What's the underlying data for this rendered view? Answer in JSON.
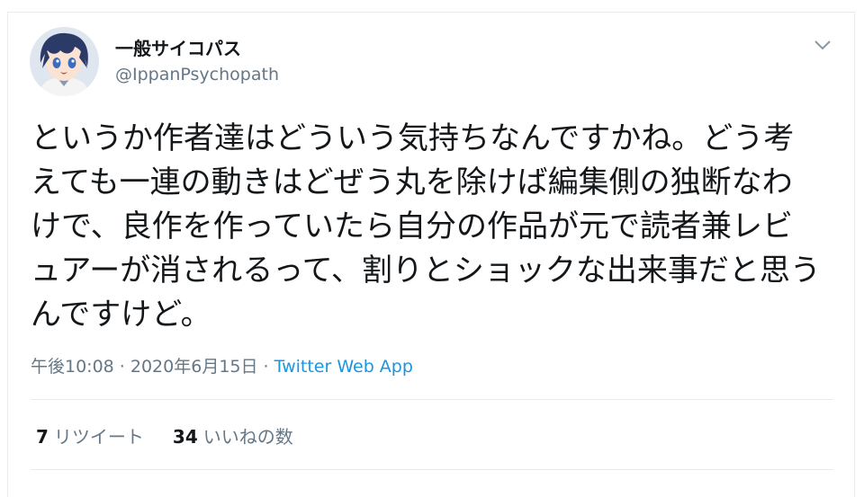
{
  "tweet": {
    "display_name": "一般サイコパス",
    "handle": "@IppanPsychopath",
    "text": "というか作者達はどういう気持ちなんですかね。どう考えても一連の動きはどぜう丸を除けば編集側の独断なわけで、良作を作っていたら自分の作品が元で読者兼レビュアーが消されるって、割りとショックな出来事だと思うんですけど。",
    "time": "午後10:08 · 2020年6月15日",
    "separator": " · ",
    "source_app": "Twitter Web App"
  },
  "stats": {
    "retweets_count": "7",
    "retweets_label": "リツイート",
    "likes_count": "34",
    "likes_label": "いいねの数"
  },
  "icons": {
    "avatar": "avatar-anime-boy",
    "caret": "chevron-down-icon"
  },
  "colors": {
    "text": "#14171a",
    "secondary": "#657786",
    "link": "#1b95e0",
    "border": "#e6ecf0"
  }
}
